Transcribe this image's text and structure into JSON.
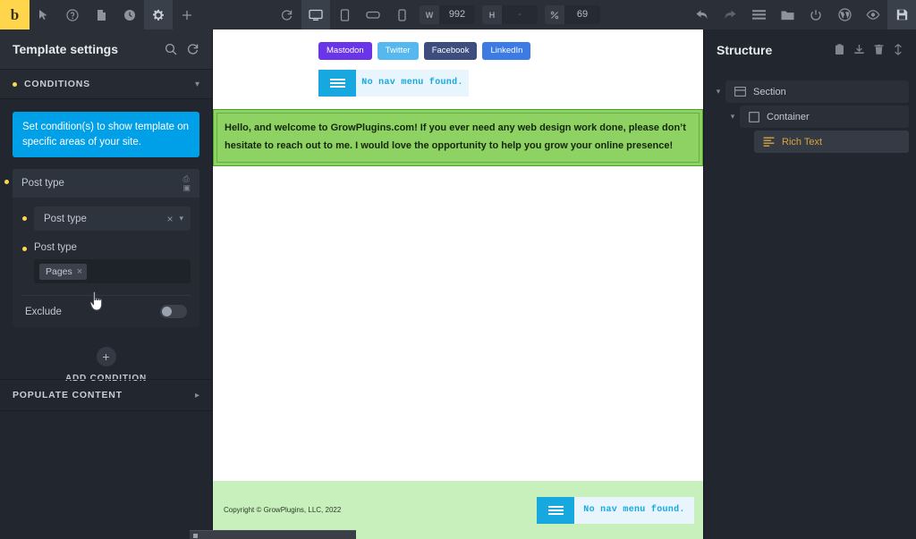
{
  "toolbar": {
    "logo": "b",
    "left_icons": [
      {
        "name": "cursor-icon",
        "label": "Select"
      },
      {
        "name": "help-icon",
        "label": "Help"
      },
      {
        "name": "page-icon",
        "label": "Pages"
      },
      {
        "name": "history-icon",
        "label": "Revisions"
      },
      {
        "name": "gear-icon",
        "label": "Settings"
      },
      {
        "name": "plus-icon",
        "label": "Add element"
      }
    ],
    "reload_label": "Reload",
    "devices": [
      {
        "name": "desktop-icon",
        "label": "Desktop",
        "active": true
      },
      {
        "name": "tablet-portrait-icon",
        "label": "Tablet portrait",
        "active": false
      },
      {
        "name": "mobile-landscape-icon",
        "label": "Mobile landscape",
        "active": false
      },
      {
        "name": "mobile-portrait-icon",
        "label": "Mobile portrait",
        "active": false
      }
    ],
    "width_label": "W",
    "width_value": "992",
    "height_label": "H",
    "height_value": "",
    "height_placeholder": "-",
    "zoom_label": "%",
    "zoom_value": "69",
    "right_icons": [
      {
        "name": "undo-icon",
        "label": "Undo"
      },
      {
        "name": "redo-icon",
        "label": "Redo"
      },
      {
        "name": "hamburger-icon",
        "label": "Menu"
      },
      {
        "name": "folder-icon",
        "label": "Templates"
      },
      {
        "name": "power-icon",
        "label": "Exit"
      },
      {
        "name": "wordpress-icon",
        "label": "WordPress"
      },
      {
        "name": "eye-icon",
        "label": "Preview"
      },
      {
        "name": "save-icon",
        "label": "Save"
      }
    ]
  },
  "left_panel": {
    "title": "Template settings",
    "header_icons": [
      {
        "name": "search-icon",
        "label": "Search"
      },
      {
        "name": "reset-icon",
        "label": "Reset"
      }
    ],
    "conditions": {
      "section_label": "CONDITIONS",
      "notice": "Set condition(s) to show template on specific areas of your site.",
      "card_title": "Post type",
      "card_icons": [
        {
          "name": "duplicate-icon",
          "label": "Duplicate"
        },
        {
          "name": "delete-icon",
          "label": "Delete"
        }
      ],
      "select_value": "Post type",
      "select_clear": "×",
      "sub_label": "Post type",
      "tags": [
        {
          "label": "Pages",
          "remove": "×"
        }
      ],
      "exclude_label": "Exclude",
      "exclude_on": false,
      "add_condition_label": "ADD CONDITION",
      "add_condition_icon": "+"
    },
    "populate_content_label": "POPULATE CONTENT"
  },
  "canvas": {
    "social_buttons": [
      {
        "label": "Mastodon",
        "color": "#6a35e6"
      },
      {
        "label": "Twitter",
        "color": "#55b9ef"
      },
      {
        "label": "Facebook",
        "color": "#3d4e7e"
      },
      {
        "label": "LinkedIn",
        "color": "#3c7ae4"
      }
    ],
    "header_nav": {
      "toggle_icon": "hamburger-icon",
      "message": "No nav menu found."
    },
    "rich_text": "Hello, and welcome to GrowPlugins.com! If you ever need any web design work done, please don’t hesitate to reach out to me. I would love the opportunity to help you grow your online presence!",
    "footer": {
      "copyright": "Copyright © GrowPlugins, LLC, 2022",
      "nav": {
        "toggle_icon": "hamburger-icon",
        "message": "No nav menu found."
      }
    }
  },
  "right_panel": {
    "title": "Structure",
    "header_icons": [
      {
        "name": "paste-icon",
        "label": "Paste"
      },
      {
        "name": "import-icon",
        "label": "Import"
      },
      {
        "name": "delete-icon",
        "label": "Delete"
      },
      {
        "name": "collapse-icon",
        "label": "Collapse all"
      }
    ],
    "tree": [
      {
        "label": "Section",
        "icon": "section-icon",
        "depth": 0,
        "selected": false,
        "expanded": true
      },
      {
        "label": "Container",
        "icon": "container-icon",
        "depth": 1,
        "selected": false,
        "expanded": true
      },
      {
        "label": "Rich Text",
        "icon": "rich-text-icon",
        "depth": 2,
        "selected": true,
        "expanded": false
      }
    ]
  },
  "colors": {
    "accent_blue": "#00a0e9",
    "accent_yellow": "#ffd54b",
    "panel_bg": "#22262e",
    "topbar_bg": "#2b3038",
    "selected_element": "#d8a33c",
    "canvas_green": "#8ed263",
    "footer_green": "#c8f0bc"
  }
}
